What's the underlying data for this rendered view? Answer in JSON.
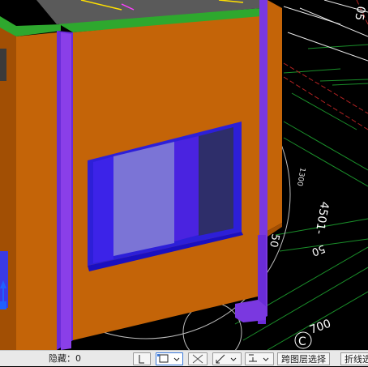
{
  "canvas": {
    "labels": {
      "c_marker": "C",
      "dim_700": "700",
      "dim_50_a": "50",
      "dim_50_b": "50",
      "dim_side": "4501-",
      "dim_top": "05",
      "dim_note": "1300"
    }
  },
  "statusbar": {
    "hidden_label": "隐藏：0",
    "cross_floor_select": "跨图层选择",
    "polyline_select": "折线选择"
  },
  "icons": {
    "axis": "axis-triad-icon",
    "snap": "snap-toggle-icon",
    "ortho": "ortho-toggle-icon",
    "close": "close-icon",
    "osnap": "object-snap-icon",
    "track": "track-icon"
  }
}
